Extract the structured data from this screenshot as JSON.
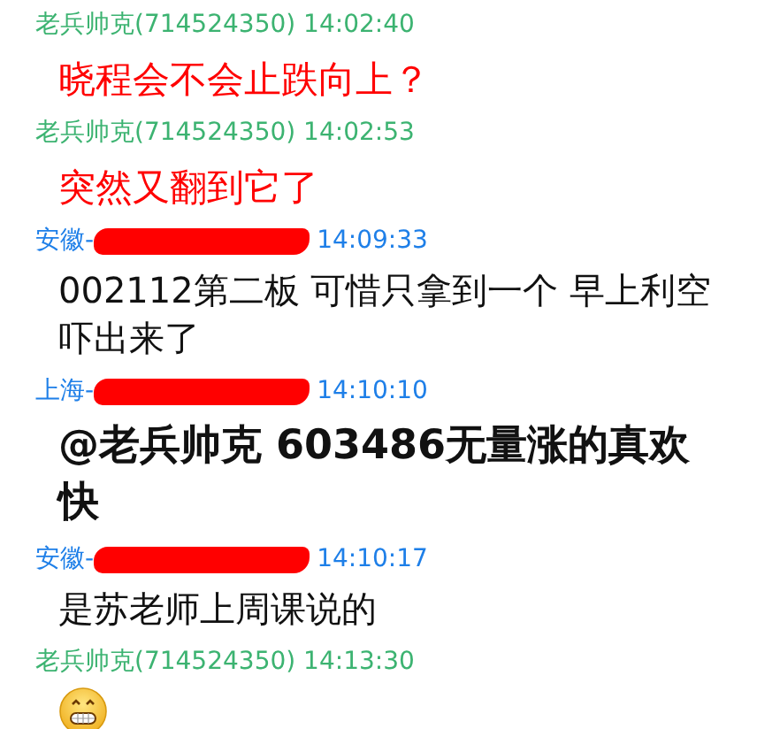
{
  "messages": [
    {
      "sender": {
        "name": "老兵帅克(714524350)",
        "time": "14:02:40",
        "color": "#3cb371"
      },
      "body": {
        "kind": "text",
        "text": "晓程会不会止跌向上？",
        "color": "#ff0000",
        "bold": false
      }
    },
    {
      "sender": {
        "name": "老兵帅克(714524350)",
        "time": "14:02:53",
        "color": "#3cb371"
      },
      "body": {
        "kind": "text",
        "text": "突然又翻到它了",
        "color": "#ff0000",
        "bold": false
      }
    },
    {
      "sender": {
        "name": "安徽-",
        "time": "14:09:33",
        "color": "#1e7fe8",
        "redacted": true
      },
      "body": {
        "kind": "text",
        "text": "002112第二板 可惜只拿到一个  早上利空吓出来了",
        "color": "#111111",
        "bold": false
      }
    },
    {
      "sender": {
        "name": "上海-",
        "time": "14:10:10",
        "color": "#1e7fe8",
        "redacted": true
      },
      "body": {
        "kind": "text",
        "text": "@老兵帅克 603486无量涨的真欢快",
        "color": "#111111",
        "bold": true
      }
    },
    {
      "sender": {
        "name": "安徽-",
        "time": "14:10:17",
        "color": "#1e7fe8",
        "redacted": true
      },
      "body": {
        "kind": "text",
        "text": "是苏老师上周课说的",
        "color": "#111111",
        "bold": false
      }
    },
    {
      "sender": {
        "name": "老兵帅克(714524350)",
        "time": "14:13:30",
        "color": "#3cb371"
      },
      "body": {
        "kind": "emoji"
      }
    }
  ]
}
